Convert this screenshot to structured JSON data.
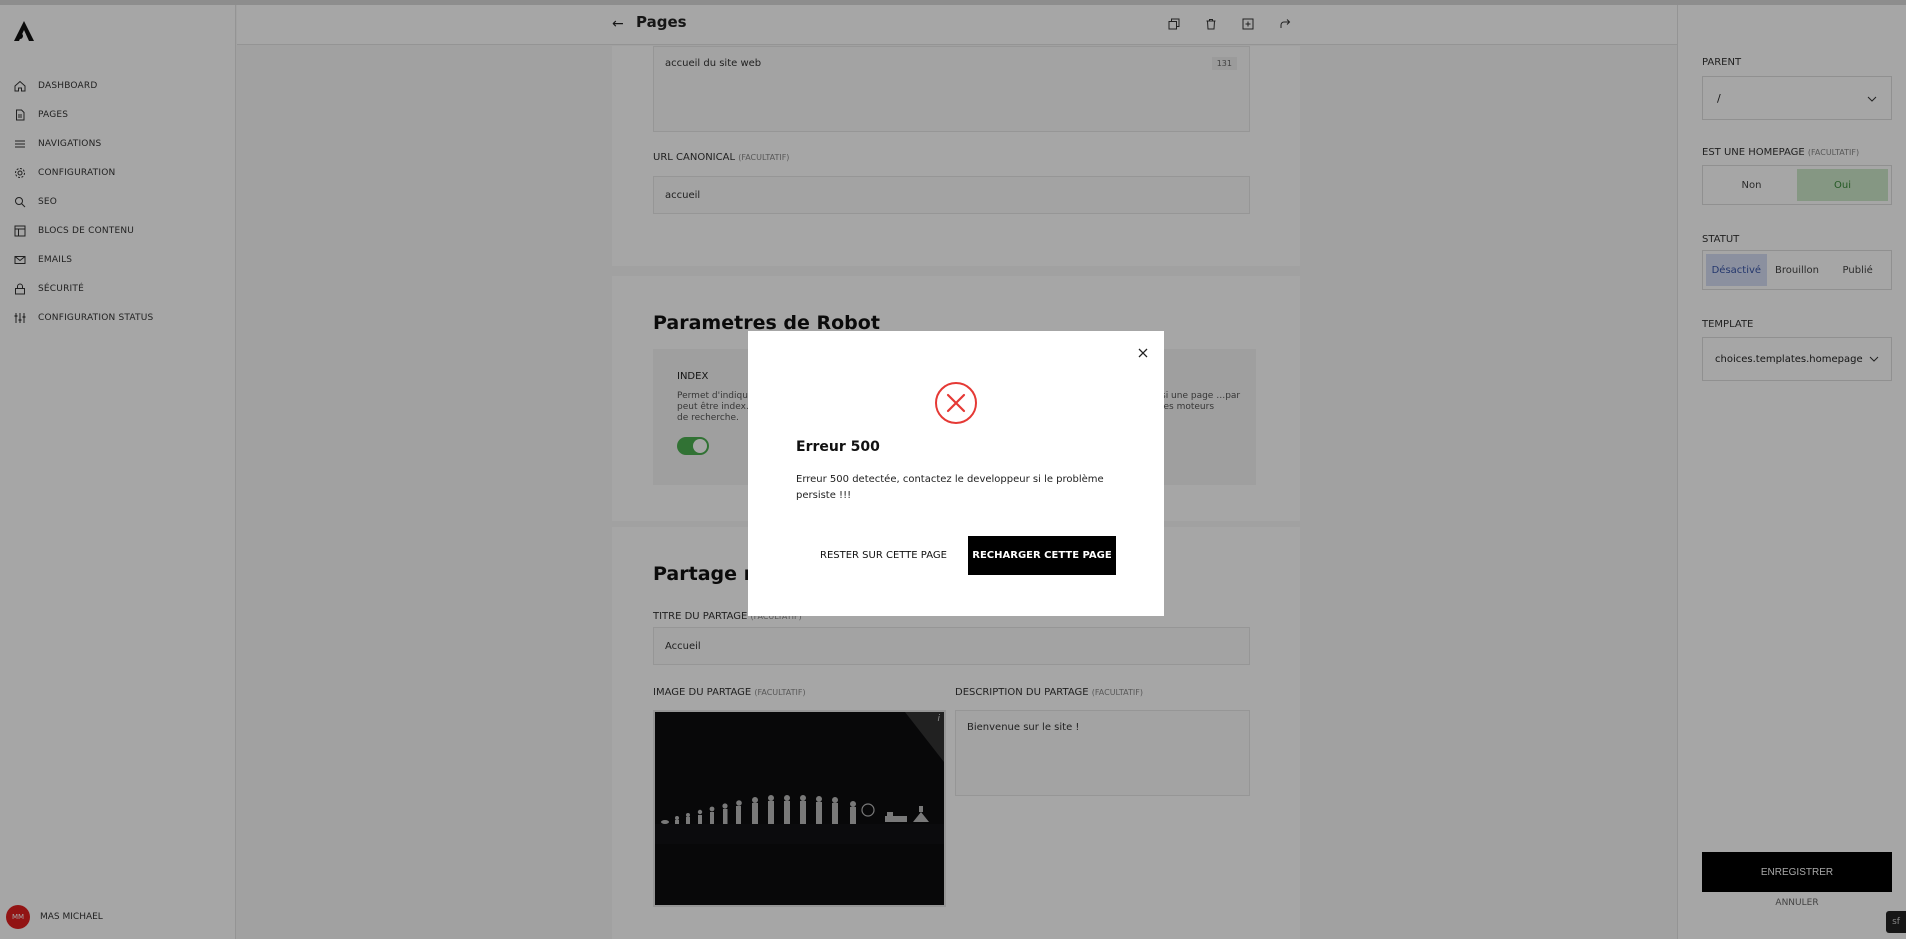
{
  "sidebar": {
    "items": [
      {
        "label": "DASHBOARD",
        "icon": "home-icon"
      },
      {
        "label": "PAGES",
        "icon": "file-icon"
      },
      {
        "label": "NAVIGATIONS",
        "icon": "menu-icon"
      },
      {
        "label": "CONFIGURATION",
        "icon": "gear-icon"
      },
      {
        "label": "SEO",
        "icon": "search-icon"
      },
      {
        "label": "BLOCS DE CONTENU",
        "icon": "layout-icon"
      },
      {
        "label": "EMAILS",
        "icon": "mail-icon"
      },
      {
        "label": "SÉCURITÉ",
        "icon": "lock-icon"
      },
      {
        "label": "CONFIGURATION STATUS",
        "icon": "sliders-icon"
      }
    ],
    "user": {
      "initials": "MM",
      "name": "MAS MICHAEL"
    }
  },
  "header": {
    "title": "Pages",
    "actions": [
      "copy-icon",
      "trash-icon",
      "add-page-icon",
      "redo-icon"
    ]
  },
  "form": {
    "description_value": "accueil du site web",
    "description_counter": "131",
    "canonical_label": "URL CANONICAL",
    "optional_tag": "(FACULTATIF)",
    "canonical_value": "accueil",
    "robot_title": "Parametres de Robot",
    "index_label": "INDEX",
    "index_desc": "Permet d'indiqu… peut être index… de recherche.",
    "follow_desc": "si une page …par les moteurs",
    "index_enabled": true,
    "share_title": "Partage ré",
    "share_title_label": "TITRE DU PARTAGE",
    "share_title_value": "Accueil",
    "share_image_label": "IMAGE DU PARTAGE",
    "share_desc_label": "DESCRIPTION DU PARTAGE",
    "share_desc_value": "Bienvenue sur le site !"
  },
  "rpanel": {
    "parent_label": "PARENT",
    "parent_value": "/",
    "homepage_label": "EST UNE HOMEPAGE",
    "homepage_optional": "(FACULTATIF)",
    "homepage_options": [
      "Non",
      "Oui"
    ],
    "homepage_selected": "Oui",
    "status_label": "STATUT",
    "status_options": [
      "Désactivé",
      "Brouillon",
      "Publié"
    ],
    "status_selected": "Désactivé",
    "template_label": "TEMPLATE",
    "template_value": "choices.templates.homepage",
    "save_label": "ENREGISTRER",
    "cancel_label": "ANNULER",
    "sf_label": "sf"
  },
  "modal": {
    "title": "Erreur 500",
    "message": "Erreur 500 detectée, contactez le developpeur si le problème persiste !!!",
    "stay_label": "RESTER SUR CETTE PAGE",
    "reload_label": "RECHARGER CETTE PAGE"
  },
  "colors": {
    "accent_green": "#4caf50",
    "error_red": "#e53935",
    "selected_blue": "#d6def5",
    "selected_green": "#cde8c9",
    "avatar_red": "#e02020"
  }
}
